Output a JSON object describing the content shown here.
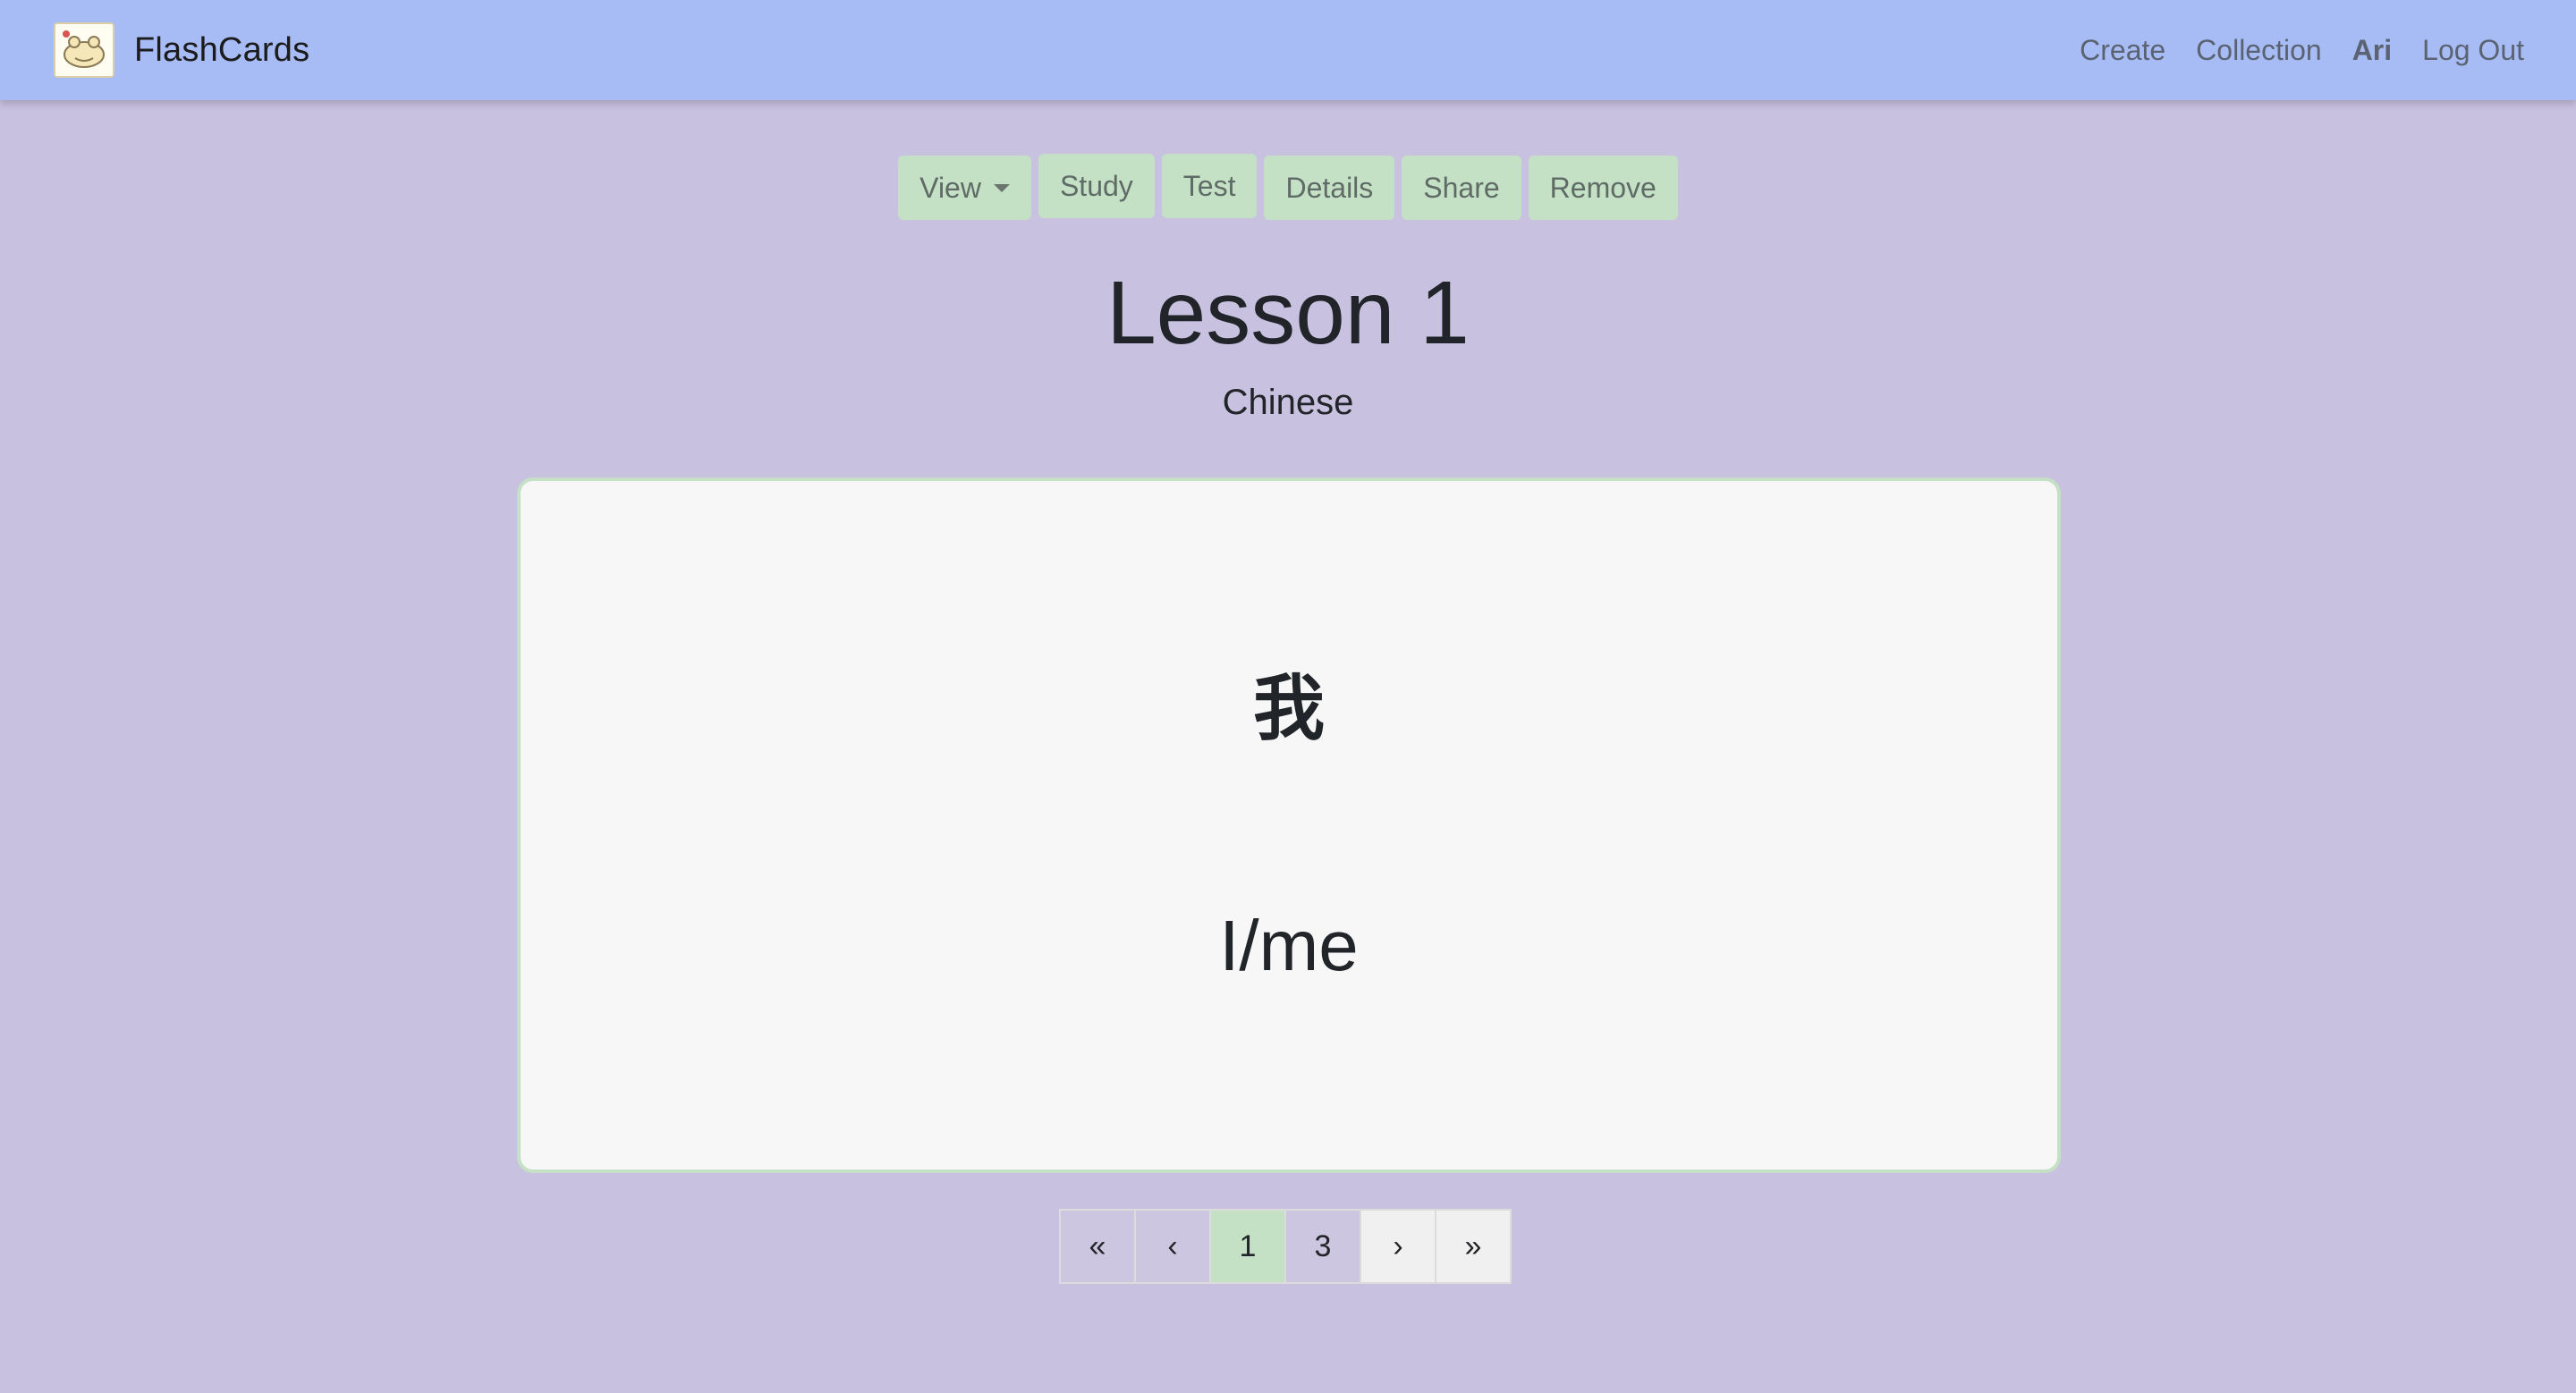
{
  "navbar": {
    "brand": "FlashCards",
    "links": {
      "create": "Create",
      "collection": "Collection",
      "user": "Ari",
      "logout": "Log Out"
    }
  },
  "toolbar": {
    "view": "View",
    "study": "Study",
    "test": "Test",
    "details": "Details",
    "share": "Share",
    "remove": "Remove"
  },
  "deck": {
    "title": "Lesson 1",
    "language": "Chinese"
  },
  "card": {
    "front": "我",
    "back": "I/me"
  },
  "pagination": {
    "first": "«",
    "prev": "‹",
    "pages": [
      "1",
      "3"
    ],
    "next": "›",
    "last": "»",
    "current": "1"
  },
  "colors": {
    "navbar": "#a7bcf5",
    "background": "#c9c1e0",
    "button": "#c5e1c5",
    "card": "#f7f7f7"
  },
  "icons": {
    "logo": "frog-logo-icon",
    "view_caret": "chevron-down-icon"
  }
}
